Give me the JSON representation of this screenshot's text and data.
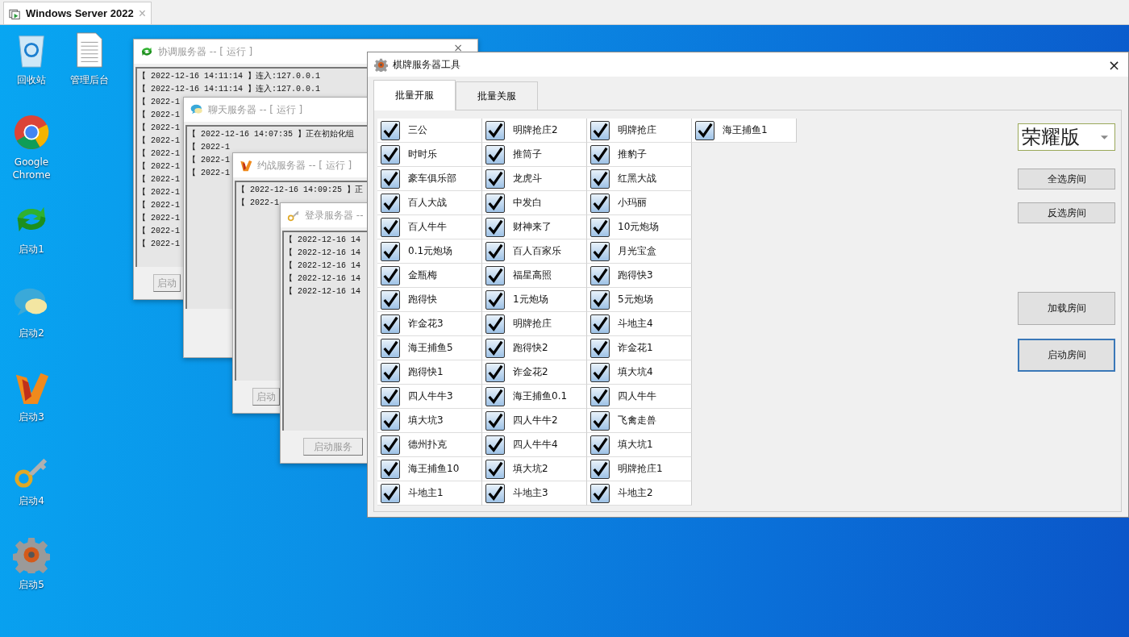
{
  "browser_tab": {
    "title": "Windows Server 2022",
    "close": "×"
  },
  "desktop_icons": [
    {
      "label": "回收站",
      "kind": "bin"
    },
    {
      "label": "管理后台",
      "kind": "doc"
    },
    {
      "label": "Google Chrome",
      "kind": "chrome"
    },
    {
      "label": "启动1",
      "kind": "arrows"
    },
    {
      "label": "启动2",
      "kind": "bubbles"
    },
    {
      "label": "启动3",
      "kind": "flame"
    },
    {
      "label": "启动4",
      "kind": "key"
    },
    {
      "label": "启动5",
      "kind": "gear"
    }
  ],
  "server_windows": [
    {
      "title": "协调服务器 -- [ 运行 ]",
      "kind": "arrows",
      "close": "×",
      "lines": [
        "【 2022-12-16 14:11:14 】连入:127.0.0.1",
        "【 2022-12-16 14:11:14 】连入:127.0.0.1",
        "【 2022-1",
        "【 2022-1",
        "【 2022-1",
        "【 2022-1",
        "【 2022-1",
        "【 2022-1",
        "【 2022-1",
        "【 2022-1",
        "【 2022-1",
        "【 2022-1",
        "【 2022-1",
        "【 2022-1"
      ],
      "button": "启动"
    },
    {
      "title": "聊天服务器 -- [ 运行 ]",
      "kind": "bubbles",
      "lines": [
        "【 2022-12-16 14:07:35 】正在初始化组",
        "【 2022-1",
        "【 2022-1",
        "【 2022-1"
      ]
    },
    {
      "title": "约战服务器 -- [ 运行 ]",
      "kind": "flame",
      "lines": [
        "【 2022-12-16 14:09:25 】正",
        "【 2022-1"
      ],
      "button": "启动"
    },
    {
      "title": "登录服务器 --",
      "kind": "key",
      "lines": [
        "【 2022-12-16 14",
        "【 2022-12-16 14",
        "【 2022-12-16 14",
        "【 2022-12-16 14",
        "【 2022-12-16 14"
      ],
      "button": "启动服务"
    }
  ],
  "main_window": {
    "title": "棋牌服务器工具",
    "close": "×",
    "tabs": [
      {
        "label": "批量开服",
        "selected": true
      },
      {
        "label": "批量关服",
        "selected": false
      }
    ],
    "room_columns": [
      [
        {
          "name": "三公",
          "checked": true
        },
        {
          "name": "时时乐",
          "checked": true
        },
        {
          "name": "豪车俱乐部",
          "checked": true
        },
        {
          "name": "百人大战",
          "checked": true
        },
        {
          "name": "百人牛牛",
          "checked": true
        },
        {
          "name": "0.1元炮场",
          "checked": true
        },
        {
          "name": "金瓶梅",
          "checked": true
        },
        {
          "name": "跑得快",
          "checked": true
        },
        {
          "name": "诈金花3",
          "checked": true
        },
        {
          "name": "海王捕鱼5",
          "checked": true
        },
        {
          "name": "跑得快1",
          "checked": true
        },
        {
          "name": "四人牛牛3",
          "checked": true
        },
        {
          "name": "填大坑3",
          "checked": true
        },
        {
          "name": "德州扑克",
          "checked": true
        },
        {
          "name": "海王捕鱼10",
          "checked": true
        },
        {
          "name": "斗地主1",
          "checked": true
        }
      ],
      [
        {
          "name": "明牌抢庄2",
          "checked": true
        },
        {
          "name": "推筒子",
          "checked": true
        },
        {
          "name": "龙虎斗",
          "checked": true
        },
        {
          "name": "中发白",
          "checked": true
        },
        {
          "name": "财神来了",
          "checked": true
        },
        {
          "name": "百人百家乐",
          "checked": true
        },
        {
          "name": "福星高照",
          "checked": true
        },
        {
          "name": "1元炮场",
          "checked": true
        },
        {
          "name": "明牌抢庄",
          "checked": true
        },
        {
          "name": "跑得快2",
          "checked": true
        },
        {
          "name": "诈金花2",
          "checked": true
        },
        {
          "name": "海王捕鱼0.1",
          "checked": true
        },
        {
          "name": "四人牛牛2",
          "checked": true
        },
        {
          "name": "四人牛牛4",
          "checked": true
        },
        {
          "name": "填大坑2",
          "checked": true
        },
        {
          "name": "斗地主3",
          "checked": true
        }
      ],
      [
        {
          "name": "明牌抢庄",
          "checked": true
        },
        {
          "name": "推豹子",
          "checked": true
        },
        {
          "name": "红黑大战",
          "checked": true
        },
        {
          "name": "小玛丽",
          "checked": true
        },
        {
          "name": "10元炮场",
          "checked": true
        },
        {
          "name": "月光宝盒",
          "checked": true
        },
        {
          "name": "跑得快3",
          "checked": true
        },
        {
          "name": "5元炮场",
          "checked": true
        },
        {
          "name": "斗地主4",
          "checked": true
        },
        {
          "name": "诈金花1",
          "checked": true
        },
        {
          "name": "填大坑4",
          "checked": true
        },
        {
          "name": "四人牛牛",
          "checked": true
        },
        {
          "name": "飞禽走兽",
          "checked": true
        },
        {
          "name": "填大坑1",
          "checked": true
        },
        {
          "name": "明牌抢庄1",
          "checked": true
        },
        {
          "name": "斗地主2",
          "checked": true
        }
      ],
      [
        {
          "name": "海王捕鱼1",
          "checked": true
        }
      ]
    ],
    "edition": "荣耀版",
    "buttons": [
      {
        "label": "全选房间",
        "kind": "small",
        "focused": false
      },
      {
        "label": "反选房间",
        "kind": "small",
        "focused": false
      },
      {
        "label": "加载房间",
        "kind": "large",
        "focused": false
      },
      {
        "label": "启动房间",
        "kind": "large",
        "focused": true
      }
    ]
  }
}
